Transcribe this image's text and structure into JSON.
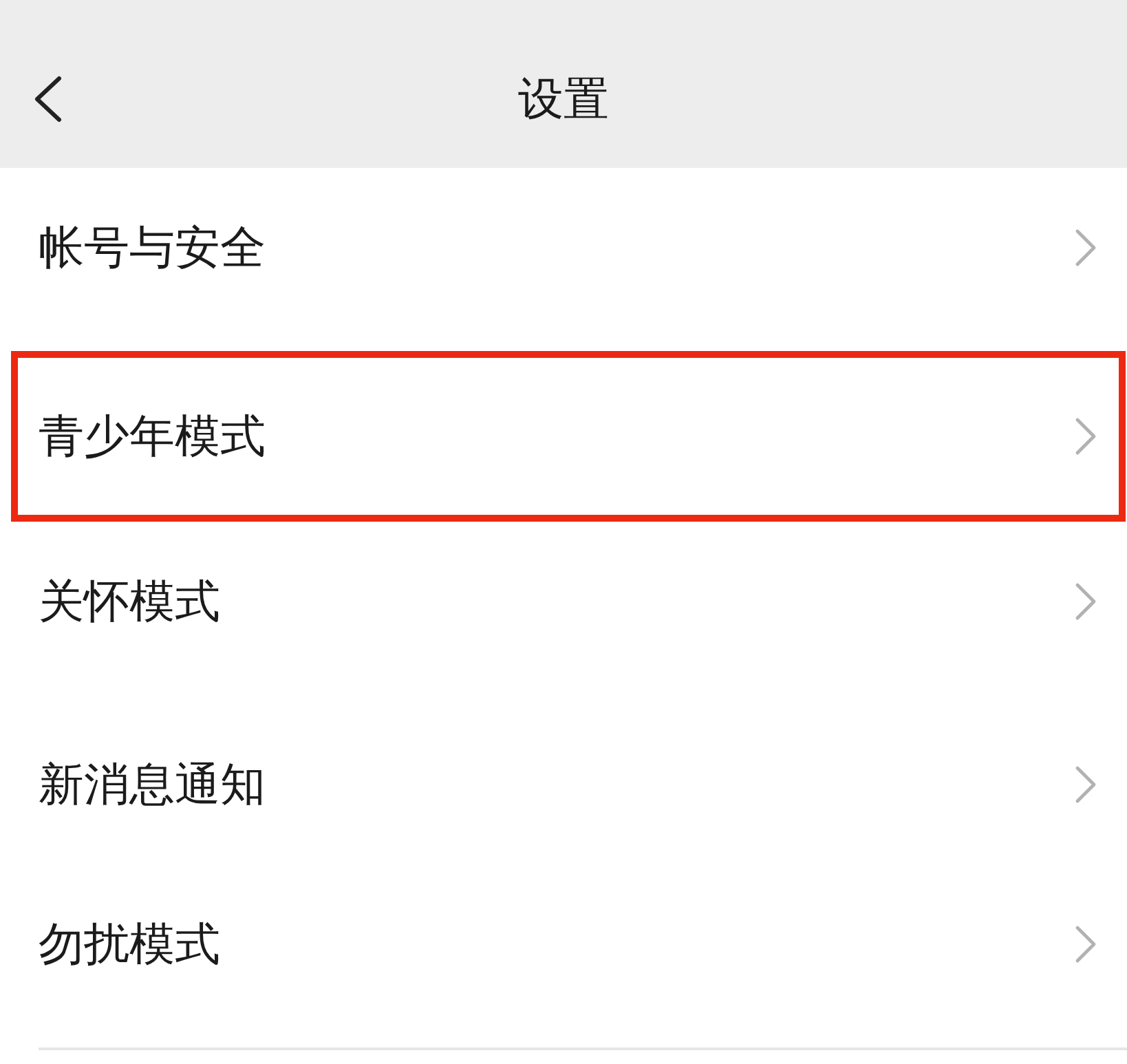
{
  "nav_bar": {
    "title": "设置"
  },
  "groups": [
    {
      "items": [
        {
          "label": "帐号与安全",
          "highlighted": false
        }
      ]
    },
    {
      "items": [
        {
          "label": "青少年模式",
          "highlighted": true
        },
        {
          "label": "关怀模式",
          "highlighted": false
        }
      ]
    },
    {
      "items": [
        {
          "label": "新消息通知",
          "highlighted": false
        },
        {
          "label": "勿扰模式",
          "highlighted": false
        }
      ]
    }
  ]
}
